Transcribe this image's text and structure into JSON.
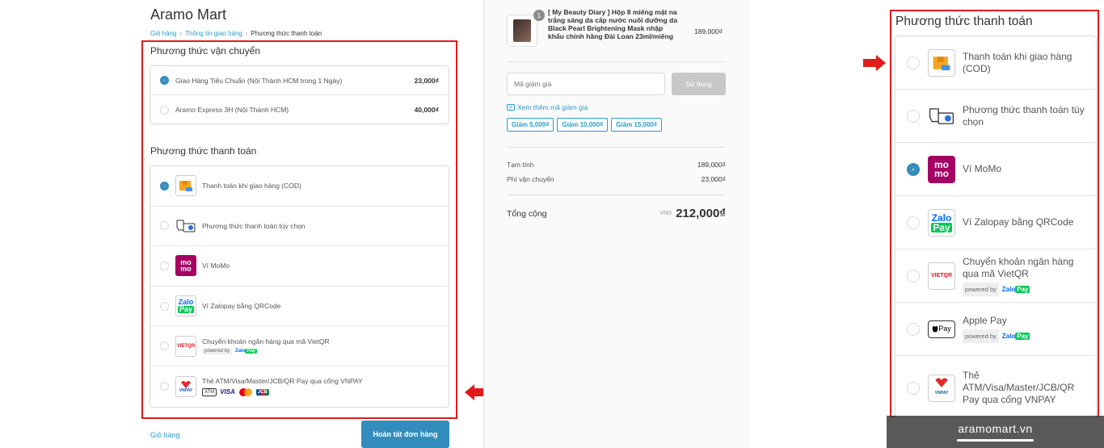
{
  "store": {
    "name": "Aramo Mart"
  },
  "breadcrumb": [
    {
      "label": "Giỏ hàng",
      "link": true
    },
    {
      "label": "Thông tin giao hàng",
      "link": true
    },
    {
      "label": "Phương thức thanh toán",
      "link": false
    }
  ],
  "shipping": {
    "title": "Phương thức vận chuyển",
    "options": [
      {
        "label": "Giao Hàng Tiêu Chuẩn (Nội Thành HCM trong 1 Ngày)",
        "price": "23,000₫",
        "selected": true
      },
      {
        "label": "Aramo Express 3H (Nội Thành HCM)",
        "price": "40,000₫",
        "selected": false
      }
    ]
  },
  "payment": {
    "title": "Phương thức thanh toán",
    "options": [
      {
        "label": "Thanh toán khi giao hàng (COD)",
        "icon": "cod-icon",
        "selected": true
      },
      {
        "label": "Phương thức thanh toán tùy chọn",
        "icon": "hand-card-icon",
        "selected": false
      },
      {
        "label": "Ví MoMo",
        "icon": "momo-icon",
        "selected": false
      },
      {
        "label": "Ví Zalopay bằng QRCode",
        "icon": "zalopay-icon",
        "selected": false
      },
      {
        "label": "Chuyển khoản ngân hàng qua mã VietQR",
        "icon": "vietqr-icon",
        "sub": "powered by",
        "selected": false
      },
      {
        "label": "Thẻ ATM/Visa/Master/JCB/QR Pay qua cổng VNPAY",
        "icon": "vnpay-icon",
        "selected": false
      }
    ]
  },
  "icon_text": {
    "momo": "mo mo",
    "zalo_1": "Zalo",
    "zalo_2": "Pay",
    "vietqr": "VIETQR",
    "vnpay": "VNPAY",
    "atm": "ATM",
    "visa": "VISA",
    "jcb": "JCB",
    "applepay": "Pay"
  },
  "footer": {
    "back_link": "Giỏ hàng",
    "finish_button": "Hoàn tất đơn hàng"
  },
  "order": {
    "quantity": "1",
    "product_name": "[ My Beauty Diary ] Hộp 8 miếng mặt na trắng sáng da cấp nước nuôi dưỡng da Black Pearl Brightening Mask nhập khẩu chính hãng Đài Loan 23ml/miếng",
    "product_price": "189,000₫",
    "discount_placeholder": "Mã giảm giá",
    "use_button": "Sử dụng",
    "more_codes": "Xem thêm mã giảm giá",
    "coupons": [
      "Giảm 5,000₫",
      "Giảm 10,000₫",
      "Giảm 15,000₫"
    ],
    "subtotal_label": "Tạm tính",
    "subtotal": "189,000₫",
    "shipping_label": "Phí vận chuyển",
    "shipping_fee": "23,000₫",
    "total_label": "Tổng cộng",
    "currency": "VND",
    "total": "212,000₫"
  },
  "zoom_panel": {
    "title": "Phương thức thanh toán",
    "options": [
      {
        "label": "Thanh toán khi giao hàng (COD)",
        "selected": false
      },
      {
        "label": "Phương thức thanh toán tùy chọn",
        "selected": false
      },
      {
        "label": "Ví MoMo",
        "selected": true
      },
      {
        "label": "Ví Zalopay bằng QRCode",
        "selected": false
      },
      {
        "label": "Chuyển khoản ngân hàng qua mã VietQR",
        "sub": "powered by",
        "selected": false
      },
      {
        "label": "Apple Pay",
        "sub": "powered by",
        "selected": false
      },
      {
        "label": "Thẻ ATM/Visa/Master/JCB/QR Pay qua cổng VNPAY",
        "selected": false
      }
    ]
  },
  "watermark": "aramomart.vn",
  "colors": {
    "accent": "#338dbc",
    "link": "#2a9dcc",
    "highlight": "#e01b1b",
    "momo": "#a50064",
    "zalopay": "#0068ff"
  }
}
